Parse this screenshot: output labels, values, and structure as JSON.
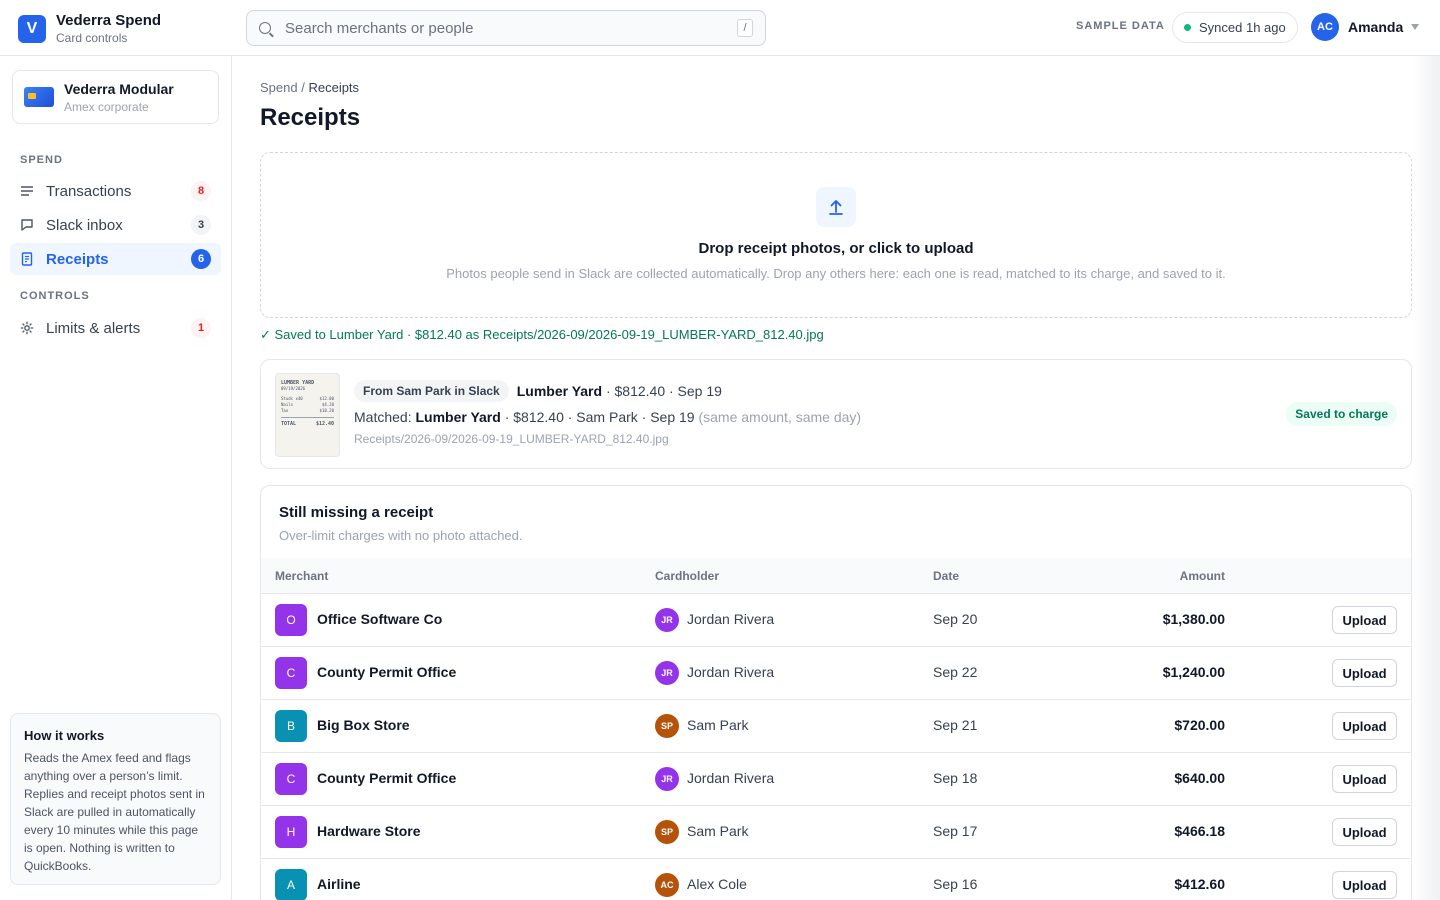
{
  "brand": {
    "logo_letter": "V",
    "name": "Vederra Spend",
    "subtitle": "Card controls"
  },
  "search": {
    "placeholder": "Search merchants or people",
    "shortcut": "/"
  },
  "header": {
    "sample_label": "SAMPLE DATA",
    "sync_status": "Synced 1h ago",
    "user_initials": "AC",
    "user_name": "Amanda"
  },
  "sidebar": {
    "card": {
      "name": "Vederra Modular",
      "subtitle": "Amex corporate"
    },
    "sections": [
      {
        "label": "SPEND"
      },
      {
        "label": "CONTROLS"
      }
    ],
    "items": [
      {
        "label": "Transactions",
        "badge": "8",
        "icon": "list-icon"
      },
      {
        "label": "Slack inbox",
        "badge": "3",
        "icon": "chat-icon"
      },
      {
        "label": "Receipts",
        "badge": "6",
        "icon": "receipt-icon"
      },
      {
        "label": "Limits & alerts",
        "badge": "1",
        "icon": "gear-icon"
      }
    ],
    "how": {
      "title": "How it works",
      "body": "Reads the Amex feed and flags anything over a person’s limit. Replies and receipt photos sent in Slack are pulled in automatically every 10 minutes while this page is open. Nothing is written to QuickBooks."
    }
  },
  "main": {
    "breadcrumb": {
      "parent": "Spend",
      "sep": "/",
      "current": "Receipts"
    },
    "title": "Receipts",
    "dropzone": {
      "title": "Drop receipt photos, or click to upload",
      "subtitle": "Photos people send in Slack are collected automatically. Drop any others here: each one is read, matched to its charge, and saved to it."
    },
    "saved_message": "✓ Saved to Lumber Yard · $812.40 as Receipts/2026-09/2026-09-19_LUMBER-YARD_812.40.jpg",
    "receipt": {
      "thumb": {
        "title": "LUMBER YARD",
        "date": "09/19/2026",
        "lines": [
          {
            "item": "Studs x40",
            "amt": "$12.00"
          },
          {
            "item": "Nails",
            "amt": "$4.20"
          },
          {
            "item": "Tax",
            "amt": "$18.20"
          }
        ],
        "total_label": "TOTAL",
        "total": "$12.40"
      },
      "source_chip": "From Sam Park in Slack",
      "merchant": "Lumber Yard",
      "details": "· $812.40 · Sep 19",
      "matched_label": "Matched:",
      "matched_merchant": "Lumber Yard",
      "matched_details": "· $812.40 · Sam Park · Sep 19",
      "matched_reason": "(same amount, same day)",
      "path": "Receipts/2026-09/2026-09-19_LUMBER-YARD_812.40.jpg",
      "status": "Saved to charge"
    },
    "missing": {
      "title": "Still missing a receipt",
      "subtitle": "Over-limit charges with no photo attached.",
      "columns": [
        "Merchant",
        "Cardholder",
        "Date",
        "Amount"
      ],
      "upload_label": "Upload",
      "rows": [
        {
          "initial": "O",
          "merchant": "Office Software Co",
          "color": "#9333ea",
          "ch_initials": "JR",
          "ch_color": "#9333ea",
          "cardholder": "Jordan Rivera",
          "date": "Sep 20",
          "amount": "$1,380.00"
        },
        {
          "initial": "C",
          "merchant": "County Permit Office",
          "color": "#9333ea",
          "ch_initials": "JR",
          "ch_color": "#9333ea",
          "cardholder": "Jordan Rivera",
          "date": "Sep 22",
          "amount": "$1,240.00"
        },
        {
          "initial": "B",
          "merchant": "Big Box Store",
          "color": "#0891b2",
          "ch_initials": "SP",
          "ch_color": "#b45309",
          "cardholder": "Sam Park",
          "date": "Sep 21",
          "amount": "$720.00"
        },
        {
          "initial": "C",
          "merchant": "County Permit Office",
          "color": "#9333ea",
          "ch_initials": "JR",
          "ch_color": "#9333ea",
          "cardholder": "Jordan Rivera",
          "date": "Sep 18",
          "amount": "$640.00"
        },
        {
          "initial": "H",
          "merchant": "Hardware Store",
          "color": "#9333ea",
          "ch_initials": "SP",
          "ch_color": "#b45309",
          "cardholder": "Sam Park",
          "date": "Sep 17",
          "amount": "$466.18"
        },
        {
          "initial": "A",
          "merchant": "Airline",
          "color": "#0891b2",
          "ch_initials": "AC",
          "ch_color": "#b45309",
          "cardholder": "Alex Cole",
          "date": "Sep 16",
          "amount": "$412.60"
        }
      ]
    }
  }
}
